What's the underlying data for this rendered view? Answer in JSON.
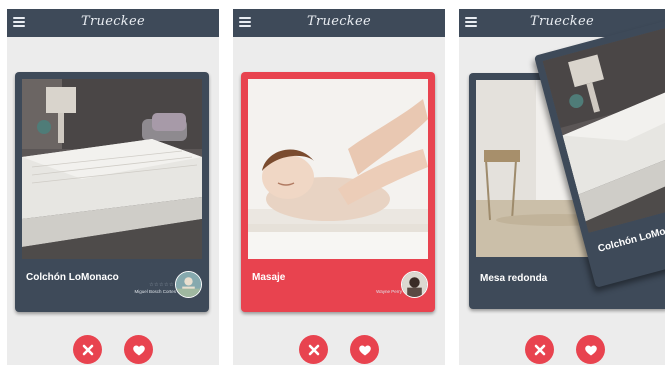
{
  "app": {
    "title": "Trueckee"
  },
  "screens": [
    {
      "card": {
        "title": "Colchón LoMonaco",
        "owner": "Miguel Bosch Cortes",
        "stars": "☆☆☆☆☆"
      }
    },
    {
      "card": {
        "title": "Masaje",
        "owner": "Wayne Perry"
      }
    },
    {
      "back_card": {
        "title": "Mesa redonda"
      },
      "front_card": {
        "title": "Colchón LoMonaco"
      }
    }
  ],
  "colors": {
    "appbar": "#3e4a59",
    "card_dark": "#3e4a59",
    "accent_red": "#e8434f",
    "background": "#ececec"
  },
  "icons": {
    "menu": "menu-icon",
    "reject": "close-icon",
    "like": "heart-icon"
  }
}
